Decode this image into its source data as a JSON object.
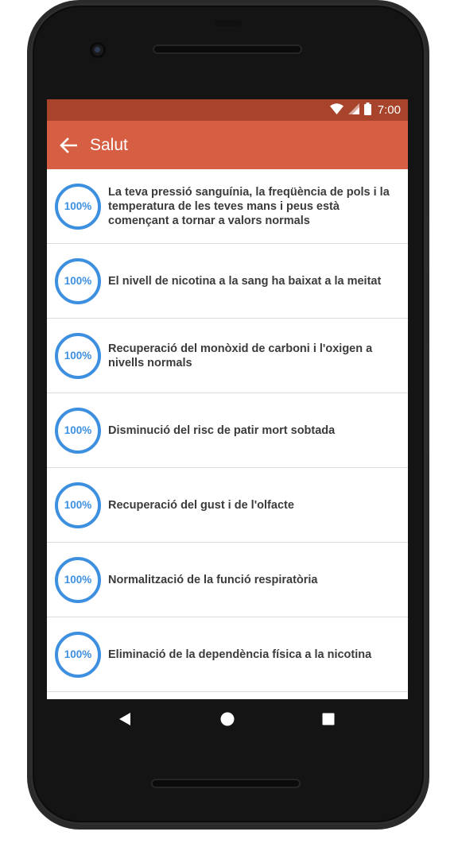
{
  "status_bar": {
    "time": "7:00",
    "icons": [
      "wifi-icon",
      "signal-icon",
      "battery-icon"
    ]
  },
  "app_bar": {
    "title": "Salut",
    "back_icon": "arrow-back-icon"
  },
  "items": [
    {
      "percent": "100%",
      "text": "La teva pressió sanguínia, la freqüència de pols i la temperatura de les teves mans i peus està començant a tornar a valors normals"
    },
    {
      "percent": "100%",
      "text": "El nivell de nicotina a la sang ha baixat a la meitat"
    },
    {
      "percent": "100%",
      "text": "Recuperació del monòxid de carboni i l'oxigen a nivells normals"
    },
    {
      "percent": "100%",
      "text": "Disminució del risc de patir mort sobtada"
    },
    {
      "percent": "100%",
      "text": "Recuperació del gust i de l'olfacte"
    },
    {
      "percent": "100%",
      "text": "Normalització de la funció respiratòria"
    },
    {
      "percent": "100%",
      "text": "Eliminació de la dependència física a la nicotina"
    }
  ],
  "nav_bar": {
    "icons": [
      "back-triangle-icon",
      "home-circle-icon",
      "recents-square-icon"
    ]
  },
  "colors": {
    "status_bar": "#a8432c",
    "app_bar": "#d65f43",
    "ring": "#3d8fe0",
    "text": "#3b3b3b"
  }
}
